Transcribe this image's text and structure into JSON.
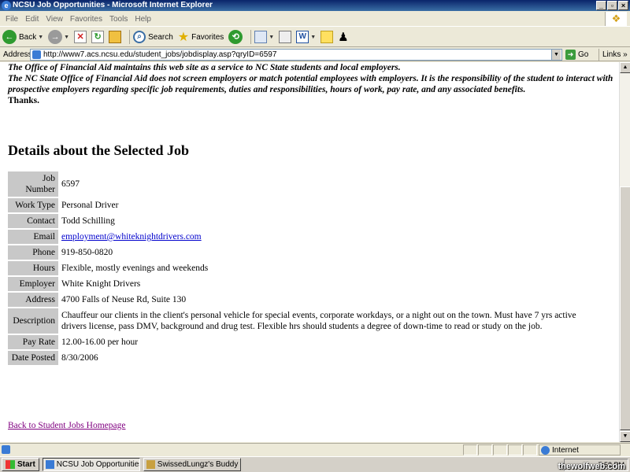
{
  "window": {
    "title": "NCSU Job Opportunities - Microsoft Internet Explorer",
    "buttons": [
      "_",
      "ř",
      "X"
    ]
  },
  "menu": [
    "File",
    "Edit",
    "View",
    "Favorites",
    "Tools",
    "Help"
  ],
  "toolbar": {
    "back_label": "Back",
    "search_label": "Search",
    "favorites_label": "Favorites"
  },
  "address": {
    "label": "Address",
    "url": "http://www7.acs.ncsu.edu/student_jobs/jobdisplay.asp?qryID=6597",
    "go_label": "Go",
    "links_label": "Links"
  },
  "notice": {
    "line1": "The Office of Financial Aid maintains this web site as a service to NC State students and local employers.",
    "line2": "The NC State Office of Financial Aid does not screen employers or match potential employees with employers. It is the responsibility of the student to interact with prospective employers regarding specific job requirements, duties and responsibilities, hours of work, pay rate, and any associated benefits.",
    "thanks": "Thanks."
  },
  "details_heading": "Details about the Selected Job",
  "job": [
    {
      "label": "Job Number",
      "value": "6597"
    },
    {
      "label": "Work Type",
      "value": "Personal Driver"
    },
    {
      "label": "Contact",
      "value": "Todd Schilling"
    },
    {
      "label": "Email",
      "value": "employment@whiteknightdrivers.com",
      "link": true
    },
    {
      "label": "Phone",
      "value": "919-850-0820"
    },
    {
      "label": "Hours",
      "value": "Flexible, mostly evenings and weekends"
    },
    {
      "label": "Employer",
      "value": "White Knight Drivers"
    },
    {
      "label": "Address",
      "value": "4700 Falls of Neuse Rd, Suite 130"
    },
    {
      "label": "Description",
      "value": "Chauffeur our clients in the client's personal vehicle for special events, corporate workdays, or a night out on the town. Must have 7 yrs active drivers license, pass DMV, background and drug test. Flexible hrs should students a degree of down-time to read or study on the job."
    },
    {
      "label": "Pay Rate",
      "value": "12.00-16.00 per hour"
    },
    {
      "label": "Date Posted",
      "value": "8/30/2006"
    }
  ],
  "back_link": "Back to Student Jobs Homepage",
  "status": {
    "zone": "Internet"
  },
  "taskbar": {
    "start": "Start",
    "tasks": [
      "NCSU Job Opportunities ...",
      "SwissedLungz's Buddy Li..."
    ],
    "clock": "7:58 PM"
  },
  "watermark": "thewolfweb.com",
  "colors": {
    "label_bg": "#c8c8c8",
    "link": "#0000cc",
    "visited_link": "#800080",
    "titlebar": "#0a246a"
  }
}
